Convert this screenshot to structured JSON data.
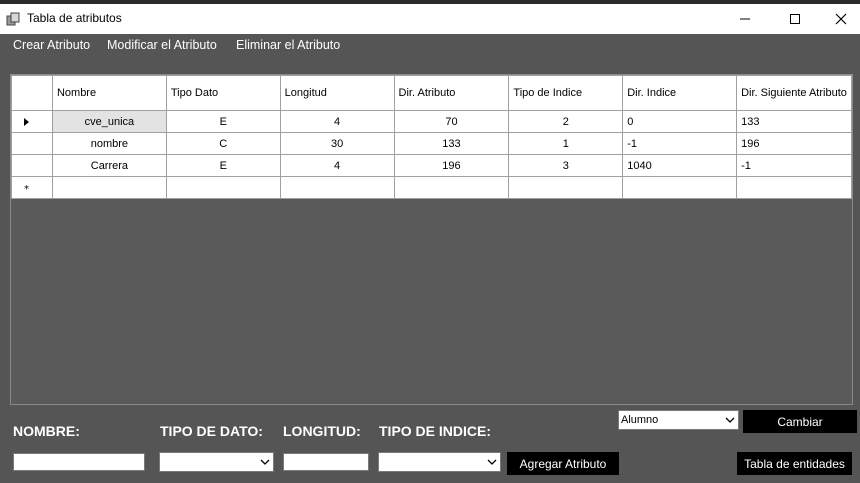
{
  "window": {
    "title": "Tabla de atributos",
    "app_icon": "app-cube-icon"
  },
  "menu": {
    "items": [
      "Crear Atributo",
      "Modificar el Atributo",
      "Eliminar el Atributo"
    ]
  },
  "grid": {
    "columns": [
      "Nombre",
      "Tipo Dato",
      "Longitud",
      "Dir. Atributo",
      "Tipo de Indice",
      "Dir. Indice",
      "Dir. Siguiente Atributo"
    ],
    "rows": [
      [
        "cve_unica",
        "E",
        "4",
        "70",
        "2",
        "0",
        "133"
      ],
      [
        "nombre",
        "C",
        "30",
        "133",
        "1",
        "-1",
        "196"
      ],
      [
        "Carrera",
        "E",
        "4",
        "196",
        "3",
        "1040",
        "-1"
      ]
    ]
  },
  "form": {
    "nombre_label": "NOMBRE:",
    "tipo_dato_label": "TIPO DE DATO:",
    "longitud_label": "LONGITUD:",
    "tipo_indice_label": "TIPO DE INDICE:",
    "agregar_button": "Agregar Atributo",
    "entity_select_value": "Alumno",
    "cambiar_button": "Cambiar",
    "tabla_entidades_button": "Tabla de entidades"
  }
}
